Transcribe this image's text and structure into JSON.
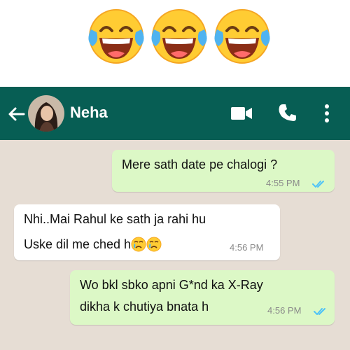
{
  "header": {
    "contact_name": "Neha",
    "icons": [
      "back-arrow-icon",
      "video-call-icon",
      "phone-call-icon",
      "more-options-icon"
    ]
  },
  "decoration": {
    "top_emojis": [
      "face-with-tears-of-joy",
      "face-with-tears-of-joy",
      "face-with-tears-of-joy"
    ]
  },
  "messages": [
    {
      "direction": "outgoing",
      "lines": [
        "Mere sath date pe chalogi ?"
      ],
      "time": "4:55 PM",
      "status": "read"
    },
    {
      "direction": "incoming",
      "lines": [
        "Nhi..Mai Rahul ke sath ja rahi hu",
        "Uske dil me ched h"
      ],
      "emojis": [
        "crying-face",
        "crying-face"
      ],
      "time": "4:56 PM"
    },
    {
      "direction": "outgoing",
      "lines": [
        "Wo bkl sbko apni G*nd ka X-Ray",
        "dikha k chutiya bnata h"
      ],
      "time": "4:56 PM",
      "status": "read"
    }
  ],
  "colors": {
    "header_bg": "#075e54",
    "chat_bg": "#e6ddd4",
    "outgoing_bubble": "#dcf8c6",
    "incoming_bubble": "#ffffff",
    "read_ticks": "#4fc3f7"
  }
}
